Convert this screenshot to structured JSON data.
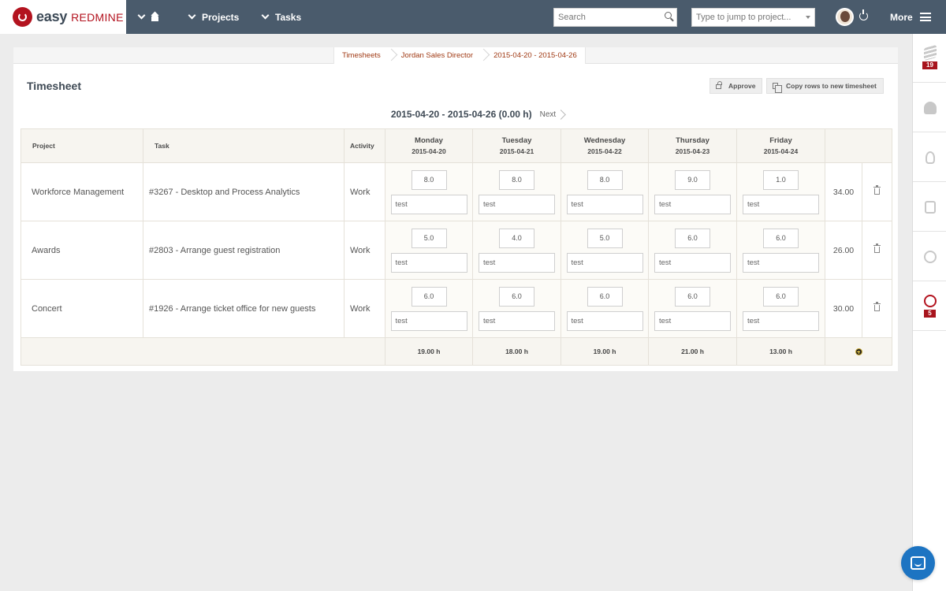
{
  "brand": {
    "easy": "easy",
    "redmine": "REDMINE"
  },
  "nav": {
    "projects": "Projects",
    "tasks": "Tasks",
    "more": "More"
  },
  "search": {
    "placeholder": "Search"
  },
  "jump": {
    "placeholder": "Type to jump to project..."
  },
  "sidebar": {
    "badge_activity": "19",
    "badge_timers": "5"
  },
  "breadcrumb": [
    "Timesheets",
    "Jordan Sales Director",
    "2015-04-20 - 2015-04-26"
  ],
  "page": {
    "title": "Timesheet",
    "approve": "Approve",
    "copy_rows": "Copy rows to new timesheet"
  },
  "period": {
    "title": "2015-04-20 - 2015-04-26 (0.00 h)",
    "next": "Next"
  },
  "table": {
    "headers": {
      "project": "Project",
      "task": "Task",
      "activity": "Activity"
    },
    "days": [
      {
        "name": "Monday",
        "date": "2015-04-20"
      },
      {
        "name": "Tuesday",
        "date": "2015-04-21"
      },
      {
        "name": "Wednesday",
        "date": "2015-04-22"
      },
      {
        "name": "Thursday",
        "date": "2015-04-23"
      },
      {
        "name": "Friday",
        "date": "2015-04-24"
      }
    ],
    "rows": [
      {
        "project": "Workforce Management",
        "task": "#3267 - Desktop and Process Analytics",
        "activity": "Work",
        "hours": [
          "8.0",
          "8.0",
          "8.0",
          "9.0",
          "1.0"
        ],
        "notes": [
          "test",
          "test",
          "test",
          "test",
          "test"
        ],
        "total": "34.00"
      },
      {
        "project": "Awards",
        "task": "#2803 - Arrange guest registration",
        "activity": "Work",
        "hours": [
          "5.0",
          "4.0",
          "5.0",
          "6.0",
          "6.0"
        ],
        "notes": [
          "test",
          "test",
          "test",
          "test",
          "test"
        ],
        "total": "26.00"
      },
      {
        "project": "Concert",
        "task": "#1926 - Arrange ticket office for new guests",
        "activity": "Work",
        "hours": [
          "6.0",
          "6.0",
          "6.0",
          "6.0",
          "6.0"
        ],
        "notes": [
          "test",
          "test",
          "test",
          "test",
          "test"
        ],
        "total": "30.00"
      }
    ],
    "day_totals": [
      "19.00 h",
      "18.00 h",
      "19.00 h",
      "21.00 h",
      "13.00 h"
    ]
  }
}
